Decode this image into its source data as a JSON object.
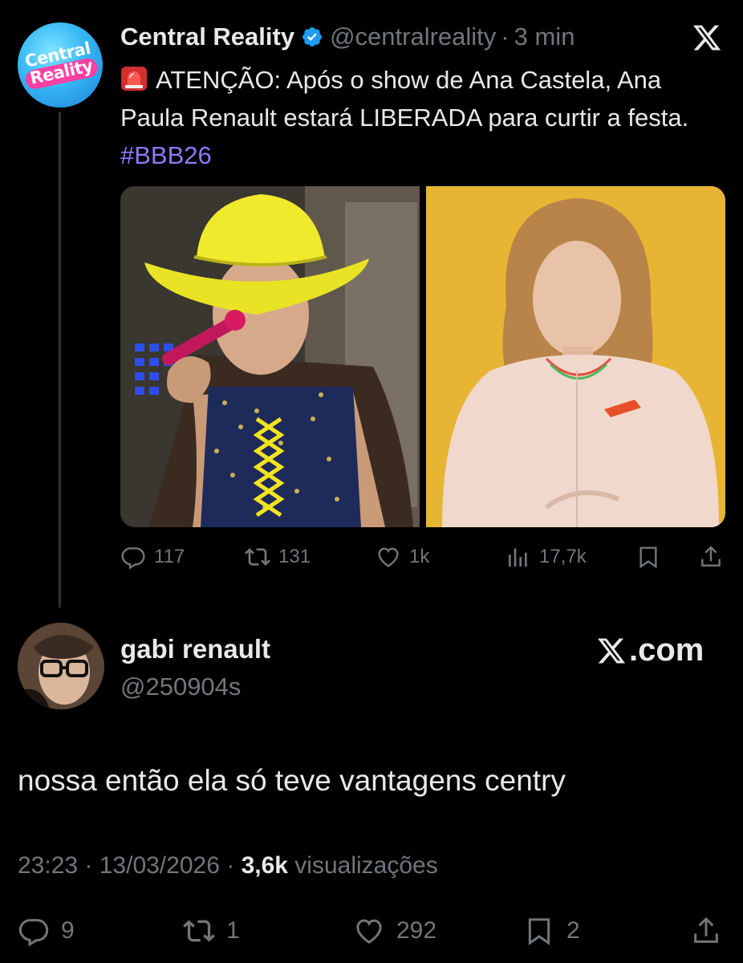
{
  "quoted_tweet": {
    "author": {
      "display_name": "Central Reality",
      "handle": "@centralreality",
      "time_ago": "3 min",
      "avatar_logo": [
        "Central",
        "Reality"
      ],
      "verified_icon": "verified-badge-icon"
    },
    "text": {
      "emoji_icon": "siren-icon",
      "line": "ATENÇÃO: Após o show de Ana Castela, Ana Paula Renault estará LIBERADA para curtir a festa.",
      "hashtag": "#BBB26"
    },
    "media": [
      {
        "icon": "photo-singer-cowboy-hat"
      },
      {
        "icon": "photo-woman-yellow-background"
      }
    ],
    "actions": {
      "replies": "117",
      "reposts": "131",
      "likes": "1k",
      "views": "17,7k"
    }
  },
  "reply": {
    "display_name": "gabi renault",
    "handle": "@250904s",
    "text": "nossa então ela só teve vantagens centry",
    "timestamp": "23:23 · 13/03/2026 ·",
    "views_count": "3,6k",
    "views_label": "visualizações",
    "actions": {
      "replies": "9",
      "reposts": "1",
      "likes": "292",
      "bookmarks": "2"
    }
  },
  "watermark": {
    "text": ".com"
  },
  "colors": {
    "background": "#000000",
    "text_primary": "#e7e9ea",
    "text_secondary": "#71767b",
    "hashtag": "#8b7cf6",
    "verified": "#1d9bf0"
  }
}
